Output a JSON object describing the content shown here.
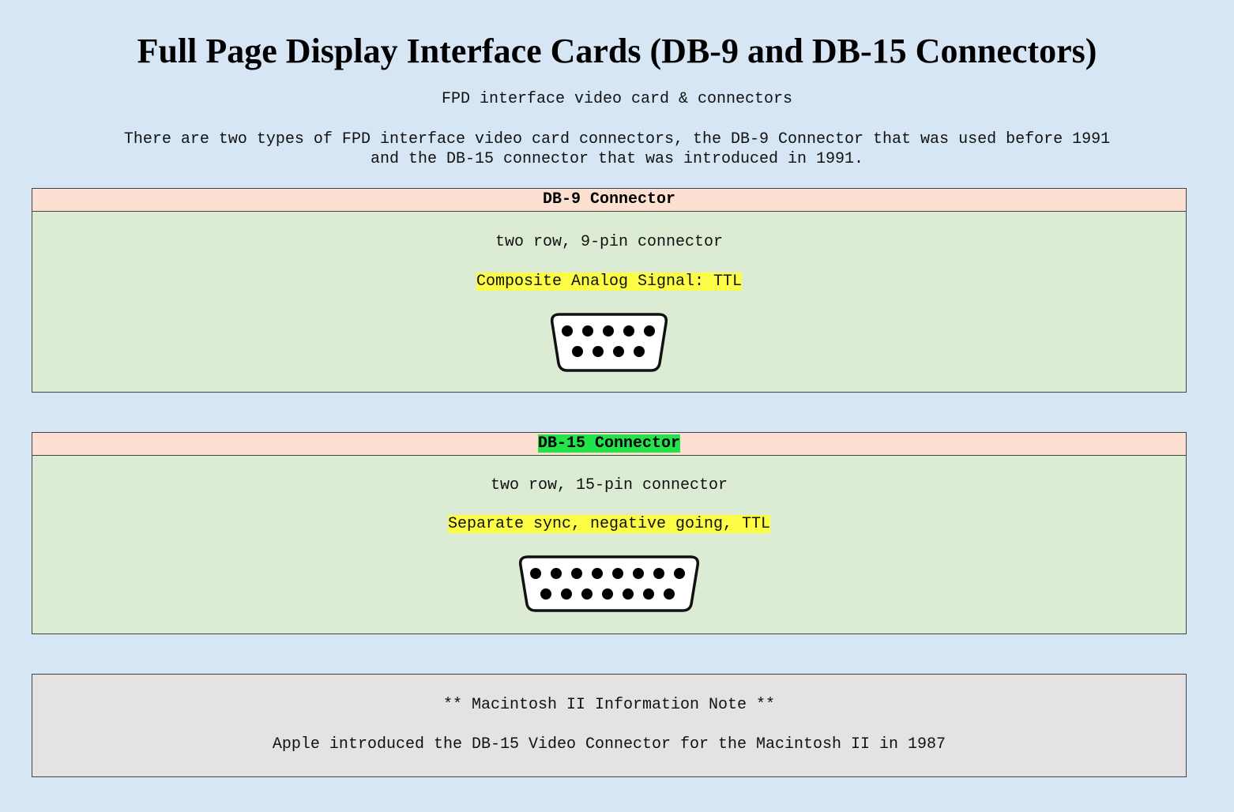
{
  "page": {
    "title": "Full Page Display Interface Cards (DB-9 and DB-15 Connectors)",
    "subtitle": "FPD interface video card & connectors",
    "intro": "There are two types of FPD interface video card connectors, the DB-9 Connector that was used before 1991 and the DB-15 connector that was introduced in 1991."
  },
  "db9": {
    "header": "DB-9 Connector",
    "description": "two row, 9-pin connector",
    "signal": "Composite Analog Signal: TTL",
    "icon": "db9-connector-icon",
    "pins_top_row": 5,
    "pins_bottom_row": 4
  },
  "db15": {
    "header": "DB-15 Connector",
    "description": "two row, 15-pin connector",
    "signal": "Separate sync, negative going, TTL",
    "icon": "db15-connector-icon",
    "pins_top_row": 8,
    "pins_bottom_row": 7
  },
  "note": {
    "title": "** Macintosh II Information Note **",
    "text": "Apple introduced the DB-15 Video Connector for the Macintosh II in 1987"
  },
  "colors": {
    "background": "#d6e6f4",
    "card_body": "#dcebd4",
    "card_header": "#fde0d2",
    "highlight_yellow": "#fdfd46",
    "highlight_green": "#22e34a",
    "note_background": "#e4e2e3"
  }
}
